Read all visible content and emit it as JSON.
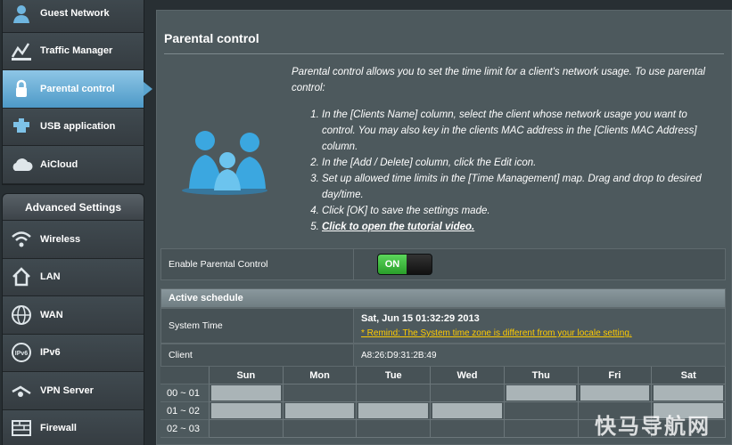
{
  "sidebar": {
    "general_items": [
      {
        "label": "Guest Network",
        "icon": "guest-network-icon"
      },
      {
        "label": "Traffic Manager",
        "icon": "traffic-manager-icon"
      },
      {
        "label": "Parental control",
        "icon": "parental-control-icon",
        "active": true
      },
      {
        "label": "USB application",
        "icon": "usb-application-icon"
      },
      {
        "label": "AiCloud",
        "icon": "aicloud-icon"
      }
    ],
    "advanced_header": "Advanced Settings",
    "advanced_items": [
      {
        "label": "Wireless",
        "icon": "wireless-icon"
      },
      {
        "label": "LAN",
        "icon": "lan-icon"
      },
      {
        "label": "WAN",
        "icon": "wan-icon"
      },
      {
        "label": "IPv6",
        "icon": "ipv6-icon"
      },
      {
        "label": "VPN Server",
        "icon": "vpn-server-icon"
      },
      {
        "label": "Firewall",
        "icon": "firewall-icon"
      }
    ]
  },
  "main": {
    "title": "Parental control",
    "intro": "Parental control allows you to set the time limit for a client's network usage. To use parental control:",
    "steps": [
      "In the [Clients Name] column, select the client whose network usage you want to control. You may also key in the clients MAC address in the [Clients MAC Address] column.",
      "In the [Add / Delete] column, click the Edit icon.",
      "Set up allowed time limits in the [Time Management] map. Drag and drop to desired day/time.",
      "Click [OK] to save the settings made."
    ],
    "tutorial_link": "Click to open the tutorial video."
  },
  "form": {
    "enable_label": "Enable Parental Control",
    "toggle_state": "ON",
    "section_title": "Active schedule",
    "system_time_label": "System Time",
    "system_time_value": "Sat, Jun 15  01:32:29  2013",
    "remind_text": "* Remind: The System time zone is different from your locale setting.",
    "client_label": "Client",
    "client_value": "A8:26:D9:31:2B:49"
  },
  "schedule": {
    "days": [
      "Sun",
      "Mon",
      "Tue",
      "Wed",
      "Thu",
      "Fri",
      "Sat"
    ],
    "rows": [
      {
        "time": "00 ~ 01",
        "selected": [
          true,
          false,
          false,
          false,
          true,
          true,
          true
        ]
      },
      {
        "time": "01 ~ 02",
        "selected": [
          true,
          true,
          true,
          true,
          false,
          false,
          true
        ]
      },
      {
        "time": "02 ~ 03",
        "selected": [
          false,
          false,
          false,
          false,
          false,
          false,
          false
        ]
      }
    ]
  },
  "watermark": "快马导航网",
  "colors": {
    "panel": "#4d595d",
    "active_menu": "#5aa4cf",
    "toggle_on": "#3bbf3b",
    "remind": "#ffcc00"
  }
}
